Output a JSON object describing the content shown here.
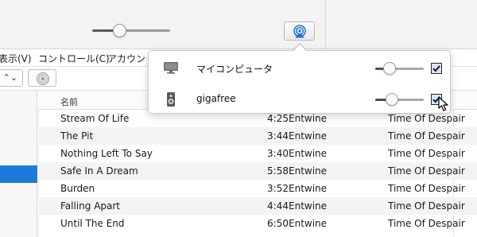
{
  "toolbar": {
    "volume": 0.35,
    "airplay_icon": "airplay-icon"
  },
  "menu": {
    "items": [
      "表示(V)",
      "コントロール(C)",
      "アカウント("
    ]
  },
  "tracklist": {
    "header": {
      "name": "名前"
    },
    "tracks": [
      {
        "name": "Stream Of Life",
        "time": "4:25",
        "artist": "Entwine",
        "album": "Time Of Despair"
      },
      {
        "name": "The Pit",
        "time": "3:44",
        "artist": "Entwine",
        "album": "Time Of Despair"
      },
      {
        "name": "Nothing Left To Say",
        "time": "3:40",
        "artist": "Entwine",
        "album": "Time Of Despair"
      },
      {
        "name": "Safe In A Dream",
        "time": "5:58",
        "artist": "Entwine",
        "album": "Time Of Despair"
      },
      {
        "name": "Burden",
        "time": "3:52",
        "artist": "Entwine",
        "album": "Time Of Despair"
      },
      {
        "name": "Falling Apart",
        "time": "4:44",
        "artist": "Entwine",
        "album": "Time Of Despair"
      },
      {
        "name": "Until The End",
        "time": "6:50",
        "artist": "Entwine",
        "album": "Time Of Despair"
      }
    ]
  },
  "airplay_popover": {
    "devices": [
      {
        "name": "マイコンピュータ",
        "icon": "computer-icon",
        "volume": 0.3,
        "checked": true
      },
      {
        "name": "gigafree",
        "icon": "speaker-icon",
        "volume": 0.35,
        "checked": true
      }
    ]
  },
  "colors": {
    "accent": "#1e7ad8",
    "toolbar_bg": "#f3f3f3",
    "row_alt": "#f3f3f3"
  }
}
